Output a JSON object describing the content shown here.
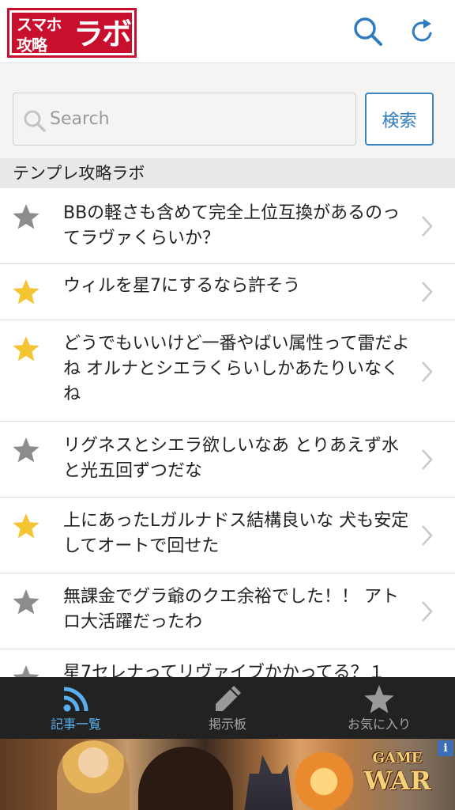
{
  "header": {
    "logo": {
      "line1": "スマホ",
      "line2": "攻略",
      "line3": "ラボ"
    },
    "search_icon": "search-icon",
    "reload_icon": "reload-icon"
  },
  "search": {
    "placeholder": "Search",
    "value": "",
    "button_label": "検索"
  },
  "section": {
    "title": "テンプレ攻略ラボ"
  },
  "articles": [
    {
      "title": "BBの軽さも含めて完全上位互換があるのってラヴァくらいか？",
      "favorite": false
    },
    {
      "title": "ウィルを星7にするなら許そう",
      "favorite": true
    },
    {
      "title": "どうでもいいけど一番やばい属性って雷だよね オルナとシエラくらいしかあたりいなくね",
      "favorite": true
    },
    {
      "title": "リグネスとシエラ欲しいなあ とりあえず水と光五回ずつだな",
      "favorite": false
    },
    {
      "title": "上にあったLガルナドス結構良いな 犬も安定してオートで回せた",
      "favorite": true
    },
    {
      "title": "無課金でグラ爺のクエ余裕でした！！ アトロ大活躍だったわ",
      "favorite": false
    },
    {
      "title": "星7セレナってリヴァイブかかってる？１",
      "favorite": false
    }
  ],
  "tabs": [
    {
      "label": "記事一覧",
      "icon": "rss-icon",
      "active": true
    },
    {
      "label": "掲示板",
      "icon": "pencil-icon",
      "active": false
    },
    {
      "label": "お気に入り",
      "icon": "star-icon",
      "active": false
    }
  ],
  "ad": {
    "line1": "GAME",
    "line2": "WAR",
    "info": "i"
  },
  "colors": {
    "accent": "#2f7bbf",
    "logo_red": "#c8102e",
    "star_favorite": "#f5c431",
    "star_default": "#8c8c8c",
    "tab_active": "#5ab0ee",
    "tab_bg": "#222222"
  }
}
